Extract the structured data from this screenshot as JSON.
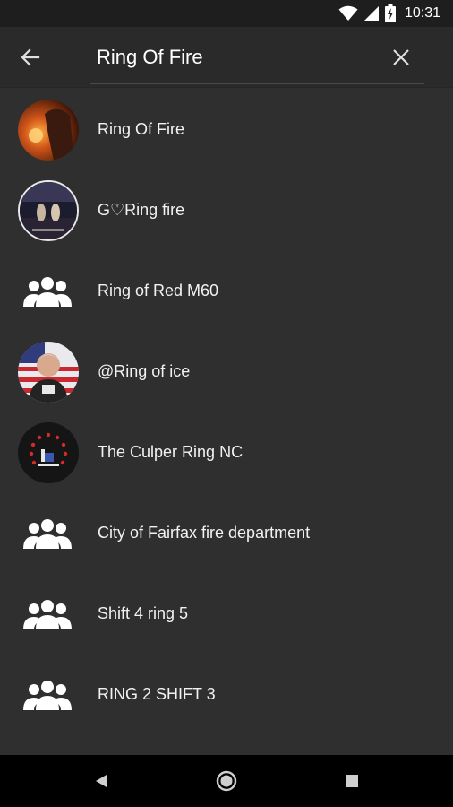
{
  "status_bar": {
    "time": "10:31",
    "icons": [
      "wifi-icon",
      "signal-icon",
      "battery-charging-icon"
    ]
  },
  "search": {
    "query": "Ring Of Fire",
    "back_icon": "arrow-left-icon",
    "clear_icon": "close-icon"
  },
  "results": [
    {
      "label": "Ring Of Fire",
      "avatar": "photo-woman-with-fire"
    },
    {
      "label": "G♡Ring fire",
      "avatar": "photo-two-figures-stage"
    },
    {
      "label": "Ring of Red M60",
      "avatar": "group-icon"
    },
    {
      "label": "@Ring of ice",
      "avatar": "photo-man-with-flag"
    },
    {
      "label": "The Culper Ring NC",
      "avatar": "logo-star-circle"
    },
    {
      "label": "City of Fairfax fire department",
      "avatar": "group-icon"
    },
    {
      "label": "Shift 4 ring 5",
      "avatar": "group-icon"
    },
    {
      "label": "RING 2 SHIFT 3",
      "avatar": "group-icon"
    }
  ],
  "nav_bar": {
    "buttons": [
      "back-triangle-icon",
      "home-circle-icon",
      "recents-square-icon"
    ]
  },
  "colors": {
    "background": "#2f2f2f",
    "search_bar": "#2a2a2a",
    "status_bar": "#1e1e1e",
    "nav_bar": "#000000",
    "text": "#ffffff"
  }
}
